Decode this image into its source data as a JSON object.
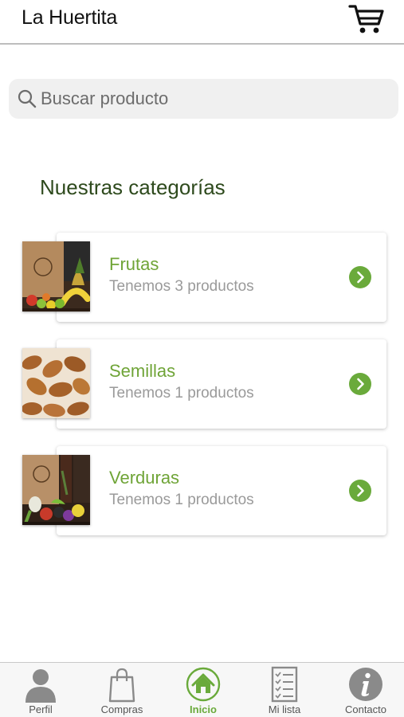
{
  "header": {
    "title": "La Huertita",
    "cart_icon": "cart-icon"
  },
  "search": {
    "placeholder": "Buscar producto",
    "icon": "search-icon"
  },
  "section_title": "Nuestras categorías",
  "categories": [
    {
      "name": "Frutas",
      "count_text": "Tenemos 3 productos",
      "image": "fruits-photo"
    },
    {
      "name": "Semillas",
      "count_text": "Tenemos 1 productos",
      "image": "almonds-photo"
    },
    {
      "name": "Verduras",
      "count_text": "Tenemos 1 productos",
      "image": "vegetables-photo"
    }
  ],
  "tabbar": {
    "tabs": [
      {
        "label": "Perfil",
        "icon": "person-icon",
        "active": false
      },
      {
        "label": "Compras",
        "icon": "shopping-bag-icon",
        "active": false
      },
      {
        "label": "Inicio",
        "icon": "home-icon",
        "active": true
      },
      {
        "label": "Mi lista",
        "icon": "checklist-icon",
        "active": false
      },
      {
        "label": "Contacto",
        "icon": "info-icon",
        "active": false
      }
    ]
  },
  "colors": {
    "accent_green": "#6aaa3b",
    "category_name_green": "#6fa437",
    "section_title_green": "#2e4a1d",
    "muted_text": "#9a9a9a",
    "search_bg": "#f0f0f0"
  }
}
